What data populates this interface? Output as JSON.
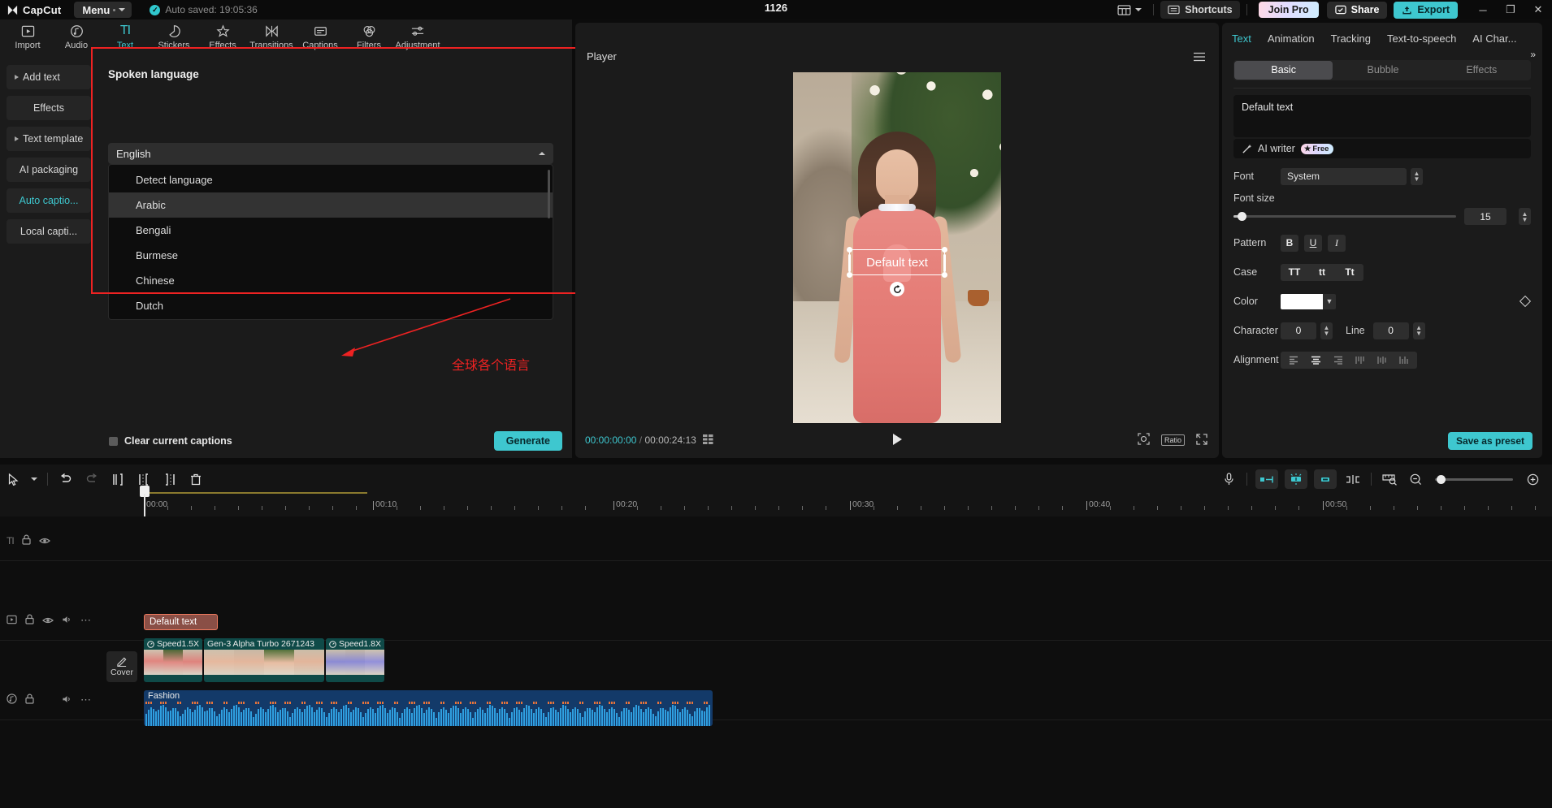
{
  "titlebar": {
    "app_name": "CapCut",
    "menu_label": "Menu",
    "autosave": "Auto saved: 19:05:36",
    "project_title": "1126",
    "shortcuts": "Shortcuts",
    "join_pro": "Join Pro",
    "share": "Share",
    "export": "Export",
    "minimize": "─",
    "maximize": "❐",
    "close": "✕"
  },
  "toolbar": {
    "items": [
      {
        "label": "Import",
        "icon": "import-icon",
        "active": false
      },
      {
        "label": "Audio",
        "icon": "audio-icon",
        "active": false
      },
      {
        "label": "Text",
        "icon": "text-icon",
        "active": true
      },
      {
        "label": "Stickers",
        "icon": "stickers-icon",
        "active": false
      },
      {
        "label": "Effects",
        "icon": "effects-icon",
        "active": false
      },
      {
        "label": "Transitions",
        "icon": "transitions-icon",
        "active": false
      },
      {
        "label": "Captions",
        "icon": "captions-icon",
        "active": false
      },
      {
        "label": "Filters",
        "icon": "filters-icon",
        "active": false
      },
      {
        "label": "Adjustment",
        "icon": "adjustment-icon",
        "active": false
      }
    ]
  },
  "left_nav": {
    "items": [
      {
        "label": "Add text",
        "expandable": true,
        "active": false
      },
      {
        "label": "Effects",
        "expandable": false,
        "active": false
      },
      {
        "label": "Text template",
        "expandable": true,
        "active": false
      },
      {
        "label": "AI packaging",
        "expandable": false,
        "active": false
      },
      {
        "label": "Auto captio...",
        "expandable": false,
        "active": true
      },
      {
        "label": "Local capti...",
        "expandable": false,
        "active": false
      }
    ]
  },
  "captions_panel": {
    "title": "Spoken language",
    "selected_language": "English",
    "options": [
      {
        "label": "Detect language",
        "highlighted": false
      },
      {
        "label": "Arabic",
        "highlighted": true
      },
      {
        "label": "Bengali",
        "highlighted": false
      },
      {
        "label": "Burmese",
        "highlighted": false
      },
      {
        "label": "Chinese",
        "highlighted": false
      },
      {
        "label": "Dutch",
        "highlighted": false
      }
    ],
    "clear_captions_label": "Clear current captions",
    "generate_label": "Generate",
    "annotation_text": "全球各个语言",
    "annotation_color": "#ee2222"
  },
  "player": {
    "title": "Player",
    "overlay_text": "Default text",
    "current_time": "00:00:00:00",
    "time_separator": "/",
    "total_time": "00:00:24:13",
    "play_icon": "play-icon",
    "ratio_label": "Ratio"
  },
  "right_panel": {
    "tabs": [
      {
        "label": "Text",
        "active": true
      },
      {
        "label": "Animation",
        "active": false
      },
      {
        "label": "Tracking",
        "active": false
      },
      {
        "label": "Text-to-speech",
        "active": false
      },
      {
        "label": "AI Char...",
        "active": false
      }
    ],
    "segments": [
      {
        "label": "Basic",
        "active": true
      },
      {
        "label": "Bubble",
        "active": false
      },
      {
        "label": "Effects",
        "active": false
      }
    ],
    "text_value": "Default text",
    "ai_writer_label": "AI writer",
    "ai_writer_badge": "Free",
    "font_label": "Font",
    "font_value": "System",
    "font_size_label": "Font size",
    "font_size_value": "15",
    "pattern_label": "Pattern",
    "pattern_buttons": [
      "B",
      "U",
      "I"
    ],
    "case_label": "Case",
    "case_buttons": [
      "TT",
      "tt",
      "Tt"
    ],
    "color_label": "Color",
    "color_value": "#ffffff",
    "character_label": "Character",
    "character_value": "0",
    "line_label": "Line",
    "line_value": "0",
    "alignment_label": "Alignment",
    "save_preset_label": "Save as preset"
  },
  "timeline": {
    "ruler_labels": [
      "00:00",
      "00:10",
      "00:20",
      "00:30",
      "00:40",
      "00:50"
    ],
    "cover_label": "Cover",
    "text_clip_label": "Default text",
    "video_clips": [
      {
        "label": "Speed1.5X",
        "badge": "speed-icon"
      },
      {
        "label": "Gen-3 Alpha Turbo 2671243",
        "badge": ""
      },
      {
        "label": "Speed1.8X",
        "badge": "speed-icon"
      }
    ],
    "audio_clip_label": "Fashion"
  },
  "colors": {
    "accent": "#3ec7cf",
    "annotation": "#ee2222",
    "panel_bg": "#1b1b1b",
    "app_bg": "#0e0e0e",
    "text_clip": "#8a4f46",
    "video_clip": "#0f4a48",
    "audio_clip": "#133a69"
  }
}
